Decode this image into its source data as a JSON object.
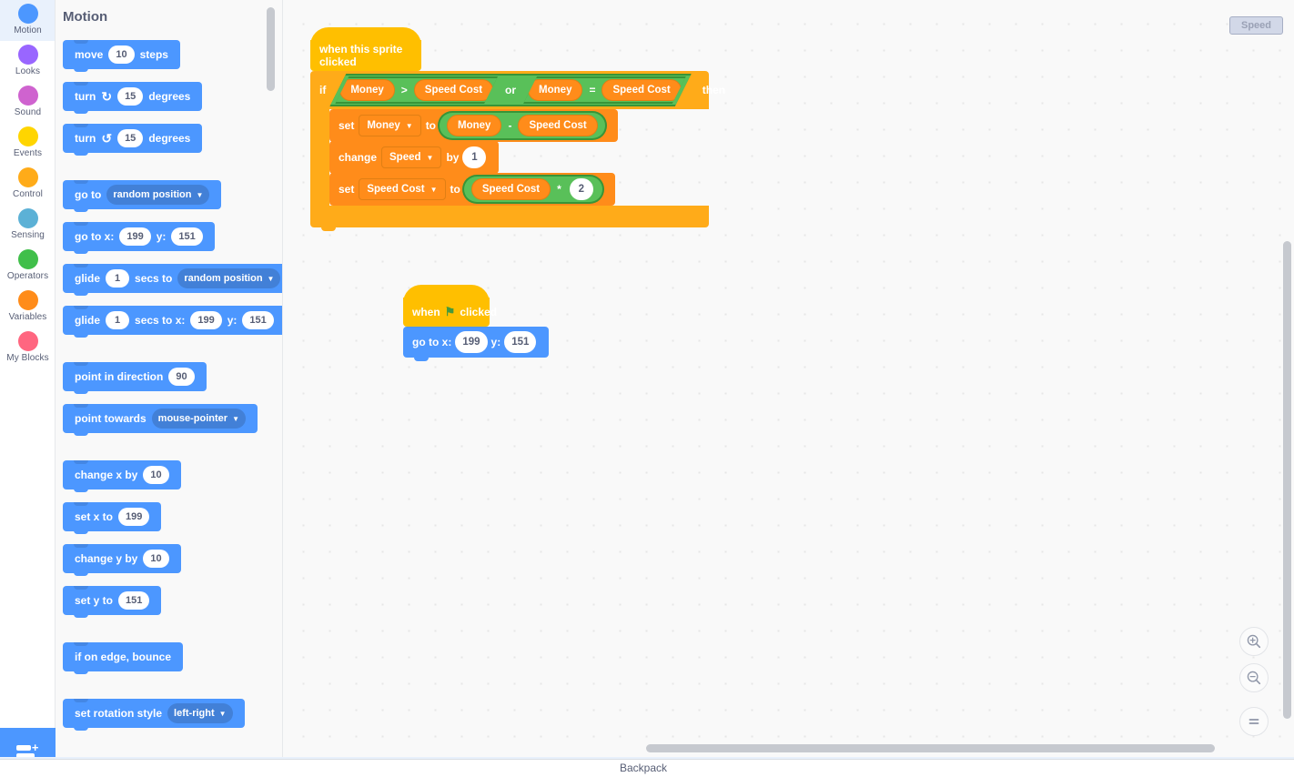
{
  "categories": [
    {
      "label": "Motion",
      "color": "#4c97ff",
      "selected": true
    },
    {
      "label": "Looks",
      "color": "#9966ff",
      "selected": false
    },
    {
      "label": "Sound",
      "color": "#cf63cf",
      "selected": false
    },
    {
      "label": "Events",
      "color": "#ffd500",
      "selected": false
    },
    {
      "label": "Control",
      "color": "#ffab19",
      "selected": false
    },
    {
      "label": "Sensing",
      "color": "#5cb1d6",
      "selected": false
    },
    {
      "label": "Operators",
      "color": "#40bf4a",
      "selected": false
    },
    {
      "label": "Variables",
      "color": "#ff8c1a",
      "selected": false
    },
    {
      "label": "My Blocks",
      "color": "#ff6680",
      "selected": false
    }
  ],
  "extension_button": {
    "name": "Add Extension"
  },
  "palette": {
    "header": "Motion",
    "blocks": {
      "move_steps": {
        "pre": "move",
        "value": "10",
        "post": "steps"
      },
      "turn_cw": {
        "pre": "turn",
        "icon": "↻",
        "value": "15",
        "post": "degrees"
      },
      "turn_ccw": {
        "pre": "turn",
        "icon": "↺",
        "value": "15",
        "post": "degrees"
      },
      "go_to": {
        "pre": "go to",
        "option": "random position"
      },
      "go_to_xy": {
        "pre": "go to x:",
        "x": "199",
        "mid": "y:",
        "y": "151"
      },
      "glide_to": {
        "pre": "glide",
        "secs": "1",
        "mid": "secs to",
        "option": "random position"
      },
      "glide_to_xy": {
        "pre": "glide",
        "secs": "1",
        "mid": "secs to x:",
        "x": "199",
        "mid2": "y:",
        "y": "151"
      },
      "point_dir": {
        "pre": "point in direction",
        "value": "90"
      },
      "point_towards": {
        "pre": "point towards",
        "option": "mouse-pointer"
      },
      "change_x": {
        "pre": "change x by",
        "value": "10"
      },
      "set_x": {
        "pre": "set x to",
        "value": "199"
      },
      "change_y": {
        "pre": "change y by",
        "value": "10"
      },
      "set_y": {
        "pre": "set y to",
        "value": "151"
      },
      "if_edge": {
        "pre": "if on edge, bounce"
      },
      "rotation": {
        "pre": "set rotation style",
        "option": "left-right"
      }
    }
  },
  "workspace": {
    "monitor": {
      "label": "Speed"
    },
    "zoom_controls": {
      "zoom_in": "+",
      "zoom_out": "−",
      "reset": "="
    },
    "script_sprite_clicked": {
      "hat": "when this sprite clicked",
      "if_keyword": "if",
      "then_keyword": "then",
      "condition": {
        "or_word": "or",
        "left": {
          "a": "Money",
          "op": ">",
          "b": "Speed Cost"
        },
        "right": {
          "a": "Money",
          "op": "=",
          "b": "Speed Cost"
        }
      },
      "body": [
        {
          "kind": "set",
          "set_word": "set",
          "target": "Money",
          "to_word": "to",
          "expr": {
            "a": "Money",
            "op": "-",
            "b": "Speed Cost"
          }
        },
        {
          "kind": "change",
          "change_word": "change",
          "target": "Speed",
          "by_word": "by",
          "value": "1"
        },
        {
          "kind": "set_mul",
          "set_word": "set",
          "target": "Speed Cost",
          "to_word": "to",
          "expr": {
            "a": "Speed Cost",
            "op": "*",
            "b": "2"
          }
        }
      ]
    },
    "script_flag_clicked": {
      "hat_pre": "when",
      "hat_flag": "⚑",
      "hat_post": "clicked",
      "go_to_xy": {
        "pre": "go to x:",
        "x": "199",
        "mid": "y:",
        "y": "151"
      }
    }
  },
  "backpack": {
    "label": "Backpack"
  }
}
